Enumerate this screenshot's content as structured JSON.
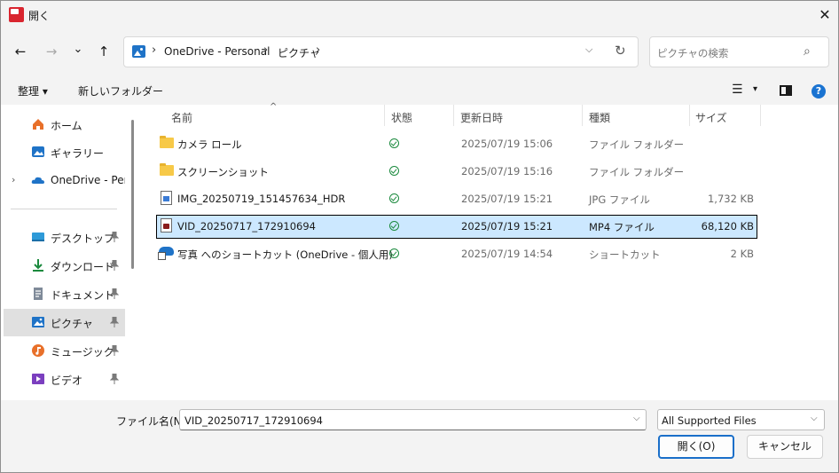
{
  "window": {
    "title": "開く",
    "close_glyph": "✕"
  },
  "nav": {
    "back_glyph": "←",
    "forward_glyph": "→",
    "recent_glyph": "⌄",
    "up_glyph": "↑",
    "breadcrumb": [
      "OneDrive - Personal",
      "ピクチャ"
    ],
    "breadcrumb_sep": "›",
    "dropdown_glyph": "⌵",
    "refresh_glyph": "↻",
    "search_placeholder": "ピクチャの検索",
    "search_glyph": "⌕"
  },
  "toolbar": {
    "organize": "整理 ▾",
    "new_folder": "新しいフォルダー",
    "view_glyph": "☰",
    "view_dd_glyph": "▾",
    "help_glyph": "?"
  },
  "sidebar": {
    "items": [
      {
        "label": "ホーム",
        "icon": "home-icon",
        "pinned": false
      },
      {
        "label": "ギャラリー",
        "icon": "gallery-icon",
        "pinned": false
      },
      {
        "label": "OneDrive - Personal",
        "icon": "onedrive-icon",
        "pinned": false
      },
      {
        "label": "デスクトップ",
        "icon": "desktop-icon",
        "pinned": true
      },
      {
        "label": "ダウンロード",
        "icon": "download-icon",
        "pinned": true
      },
      {
        "label": "ドキュメント",
        "icon": "document-icon",
        "pinned": true
      },
      {
        "label": "ピクチャ",
        "icon": "pictures-icon",
        "pinned": true,
        "selected": true
      },
      {
        "label": "ミュージック",
        "icon": "music-icon",
        "pinned": true
      },
      {
        "label": "ビデオ",
        "icon": "video-icon",
        "pinned": true
      }
    ],
    "expand_glyph": "›",
    "pin_glyph": "📌"
  },
  "file_list": {
    "sort_glyph": "^",
    "columns": [
      "名前",
      "状態",
      "更新日時",
      "種類",
      "サイズ"
    ],
    "rows": [
      {
        "name": "カメラ ロール",
        "date": "2025/07/19 15:06",
        "type": "ファイル フォルダー",
        "size": "",
        "icon": "folder-icon"
      },
      {
        "name": "スクリーンショット",
        "date": "2025/07/19 15:16",
        "type": "ファイル フォルダー",
        "size": "",
        "icon": "folder-icon"
      },
      {
        "name": "IMG_20250719_151457634_HDR",
        "date": "2025/07/19 15:21",
        "type": "JPG ファイル",
        "size": "1,732 KB",
        "icon": "image-file-icon"
      },
      {
        "name": "VID_20250717_172910694",
        "date": "2025/07/19 15:21",
        "type": "MP4 ファイル",
        "size": "68,120 KB",
        "icon": "video-file-icon",
        "selected": true
      },
      {
        "name": "写真 へのショートカット (OneDrive - 個人用)",
        "date": "2025/07/19 14:54",
        "type": "ショートカット",
        "size": "2 KB",
        "icon": "onedrive-shortcut-icon"
      }
    ]
  },
  "footer": {
    "filename_label": "ファイル名(N):",
    "filename_value": "VID_20250717_172910694",
    "filetype_value": "All Supported Files",
    "dd_glyph": "⌵",
    "open_label": "開く(O)",
    "cancel_label": "キャンセル"
  },
  "colors": {
    "accent": "#1a6fc9",
    "selection": "#cce8ff",
    "status_ok": "#1b8a3e"
  }
}
